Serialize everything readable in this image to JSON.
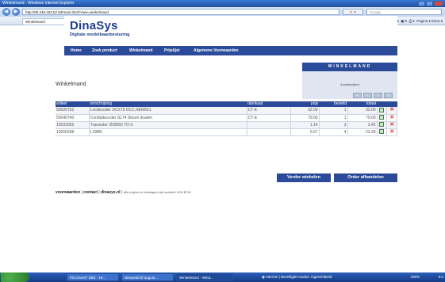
{
  "window": {
    "title": "Winkelmand - Windows Internet Explorer"
  },
  "addressbar": {
    "url": "http://80.248.193.52.83/main.html?view=winkelmand",
    "search_placeholder": "Google"
  },
  "tabs": [
    {
      "label": "Winkelmand"
    },
    {
      "label": "Dashboard - www.picom..."
    },
    {
      "label": "Certificaatfout: navigatie ..."
    },
    {
      "label": "Google"
    }
  ],
  "toolbar": {
    "tools_label": "Pagina ▾  Extra ▾"
  },
  "site": {
    "logo_title": "DinaSys",
    "logo_subtitle": "Digitale modelbaanbesturing",
    "menu": [
      "Home",
      "Zoek product",
      "Winkelmand",
      "Prijslijst",
      "Algemene Voorwaarden"
    ]
  },
  "page": {
    "title": "Winkelmand"
  },
  "cart_box": {
    "header": "WINKELMAND",
    "count": "4 product(en)"
  },
  "table": {
    "headers": [
      "artikel",
      "omschrijving",
      "fabrikaat",
      "prijs",
      "besteld",
      "totaal"
    ],
    "rows": [
      {
        "artikel": "50020752",
        "omschrijving": "Locdecoder DCX75 DCC.NEM651",
        "fabrikaat": "CT-E",
        "prijs": "32.00",
        "besteld": "1",
        "totaal": "32.00"
      },
      {
        "artikel": "50040740",
        "omschrijving": "Combidecoder SL74 Stoom draden",
        "fabrikaat": "CT-E",
        "prijs": "79.00",
        "besteld": "1",
        "totaal": "79.00"
      },
      {
        "artikel": "10033055",
        "omschrijving": "Transistor 2N3055 TO-3",
        "fabrikaat": "",
        "prijs": "1.14",
        "besteld": "3",
        "totaal": "3.42"
      },
      {
        "artikel": "10050298",
        "omschrijving": "L298N",
        "fabrikaat": "",
        "prijs": "5.57",
        "besteld": "4",
        "totaal": "22.28"
      }
    ]
  },
  "buttons": {
    "continue": "Verder winkelen",
    "checkout": "Order afhandelen"
  },
  "footer": {
    "link_terms": "voorwaarden",
    "link_contact": "contact",
    "link_site": "dinasys.nl",
    "note": "Alle prijzen en bedragen zijn inclusief 19% BTW"
  },
  "statusbar": {
    "zone": "Internet | Beveiligde modus: ingeschakeld",
    "zoom": "100%"
  },
  "taskbar": {
    "tasks": [
      "PiComm07 SBS - 19...",
      "Nieuwsbrief august...",
      "Winkelmand - Wind..."
    ],
    "clock": "9:2"
  },
  "colors": {
    "brand_blue": "#2b4a9a",
    "delete_red": "#dd3333"
  }
}
